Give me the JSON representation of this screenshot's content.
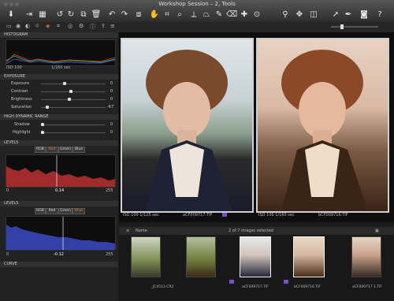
{
  "window": {
    "title": "Workshop Session – 2, Tools"
  },
  "colors": {
    "accent_orange": "#e67e22",
    "selected_purple": "#7a4dcc",
    "blue_hist": "#3340a8",
    "red_hist": "#a12a2a"
  },
  "toolbar": {
    "icons": [
      "download-icon",
      "import-icon",
      "grid-icon",
      "rotate-left-icon",
      "rotate-right-icon",
      "trash-icon",
      "undo-icon",
      "redo-icon",
      "compare-icon",
      "crop-icon",
      "straighten-icon",
      "keystone-icon",
      "brush-icon",
      "eraser-icon",
      "picker-icon",
      "clone-icon",
      "search-icon",
      "move-icon",
      "mask-icon",
      "cursor-icon",
      "pick-icon",
      "camera-icon",
      "help-icon"
    ]
  },
  "left_panel": {
    "histogram": {
      "title": "HISTOGRAM",
      "iso": "ISO 100",
      "shutter": "1/160 sec"
    },
    "exposure": {
      "title": "EXPOSURE",
      "rows": [
        {
          "label": "Exposure",
          "value": "0"
        },
        {
          "label": "Contrast",
          "value": "0"
        },
        {
          "label": "Brightness",
          "value": "0"
        },
        {
          "label": "Saturation",
          "value": "-67"
        }
      ]
    },
    "hdr": {
      "title": "HIGH DYNAMIC RANGE",
      "rows": [
        {
          "label": "Shadow",
          "value": "0"
        },
        {
          "label": "Highlight",
          "value": "0"
        }
      ]
    },
    "levels1": {
      "title": "LEVELS",
      "tabs": [
        "RGB",
        "Red",
        "Green",
        "Blue"
      ],
      "left": "0",
      "mid": "0.14",
      "right": "255"
    },
    "levels2": {
      "title": "LEVELS",
      "tabs": [
        "RGB",
        "Red",
        "Green",
        "Blue"
      ],
      "left": "0",
      "mid": "-0.12",
      "right": "255"
    },
    "curve": {
      "title": "CURVE"
    }
  },
  "viewer": {
    "left_info": "ISO 100   1/125 sec",
    "left_file": "aCF009717.TIF",
    "right_info": "ISO 100   1/160 sec",
    "right_file": "bCF009716.TIF"
  },
  "filmbar": {
    "sort": "Name",
    "count": "2 of 7 images selected"
  },
  "filmstrip": {
    "captions": [
      "_JC4513.CR2",
      "aCF009717.TIF",
      "bCF009716.TIF",
      "aCF009717 1.TIF"
    ]
  }
}
